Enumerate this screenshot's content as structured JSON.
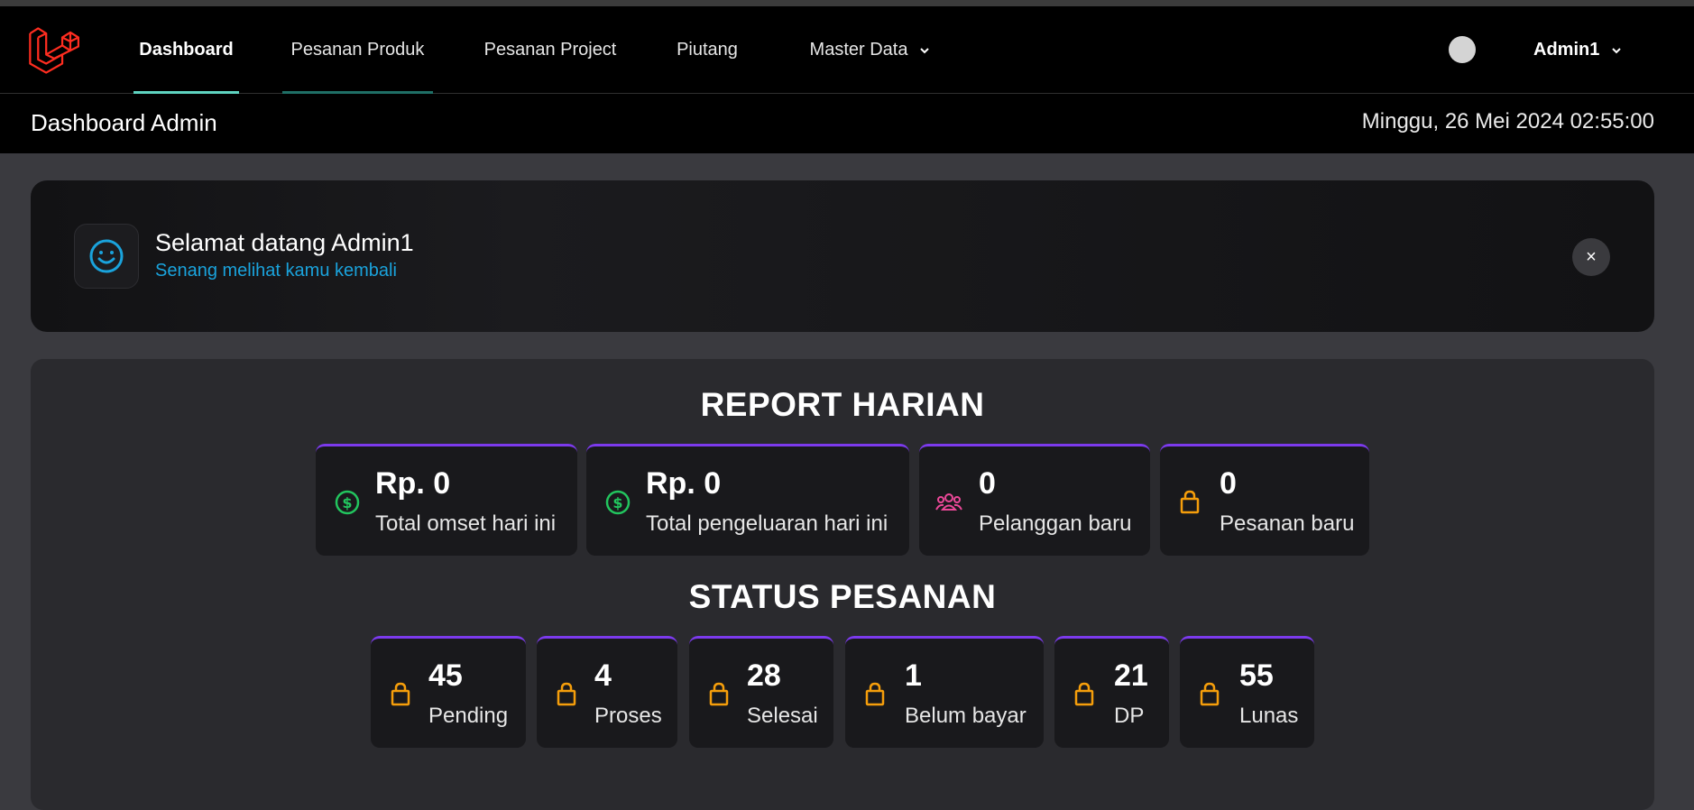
{
  "nav": {
    "items": [
      {
        "label": "Dashboard"
      },
      {
        "label": "Pesanan Produk"
      },
      {
        "label": "Pesanan Project"
      },
      {
        "label": "Piutang"
      },
      {
        "label": "Master Data"
      }
    ],
    "user": "Admin1"
  },
  "subheader": {
    "title": "Dashboard Admin",
    "datetime": "Minggu, 26 Mei 2024 02:55:00"
  },
  "welcome": {
    "title": "Selamat datang Admin1",
    "subtitle": "Senang melihat kamu kembali",
    "close": "×"
  },
  "report": {
    "title": "REPORT HARIAN",
    "cards": [
      {
        "value": "Rp. 0",
        "label": "Total omset hari ini",
        "icon": "dollar-circle-icon",
        "color": "#22c55e"
      },
      {
        "value": "Rp. 0",
        "label": "Total pengeluaran hari ini",
        "icon": "dollar-circle-icon",
        "color": "#22c55e"
      },
      {
        "value": "0",
        "label": "Pelanggan baru",
        "icon": "users-icon",
        "color": "#ec4899"
      },
      {
        "value": "0",
        "label": "Pesanan baru",
        "icon": "shopping-bag-icon",
        "color": "#f59e0b"
      }
    ]
  },
  "status": {
    "title": "STATUS PESANAN",
    "cards": [
      {
        "value": "45",
        "label": "Pending",
        "icon": "shopping-bag-icon"
      },
      {
        "value": "4",
        "label": "Proses",
        "icon": "shopping-bag-icon"
      },
      {
        "value": "28",
        "label": "Selesai",
        "icon": "shopping-bag-icon"
      },
      {
        "value": "1",
        "label": "Belum bayar",
        "icon": "shopping-bag-icon"
      },
      {
        "value": "21",
        "label": "DP",
        "icon": "shopping-bag-icon"
      },
      {
        "value": "55",
        "label": "Lunas",
        "icon": "shopping-bag-icon"
      }
    ]
  },
  "colors": {
    "accent_active": "#5ed3c0",
    "card_border": "#7c3aed",
    "link": "#1aa3dc",
    "bag": "#f59e0b"
  }
}
